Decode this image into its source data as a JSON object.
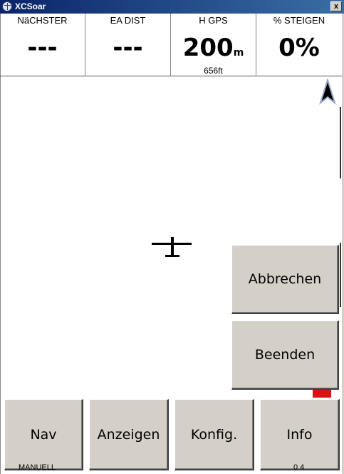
{
  "window": {
    "title": "XCSoar",
    "close_label": "x"
  },
  "infoboxes": [
    {
      "label": "NäCHSTER",
      "value": "---",
      "unit": "",
      "sub": ""
    },
    {
      "label": "EA DIST",
      "value": "---",
      "unit": "",
      "sub": ""
    },
    {
      "label": "H GPS",
      "value": "200",
      "unit": "m",
      "sub": "656ft"
    },
    {
      "label": "% STEIGEN",
      "value": "0%",
      "unit": "",
      "sub": ""
    }
  ],
  "menu": {
    "abbrechen": "Abbrechen",
    "beenden": "Beenden",
    "nav": "Nav",
    "anzeigen": "Anzeigen",
    "konfig": "Konfig.",
    "info": "Info"
  },
  "map_labels": {
    "bottom_left": "MANUELL",
    "bottom_right": "0 4"
  },
  "icons": [
    "app-icon",
    "close-icon",
    "north-arrow-icon",
    "glider-icon"
  ]
}
